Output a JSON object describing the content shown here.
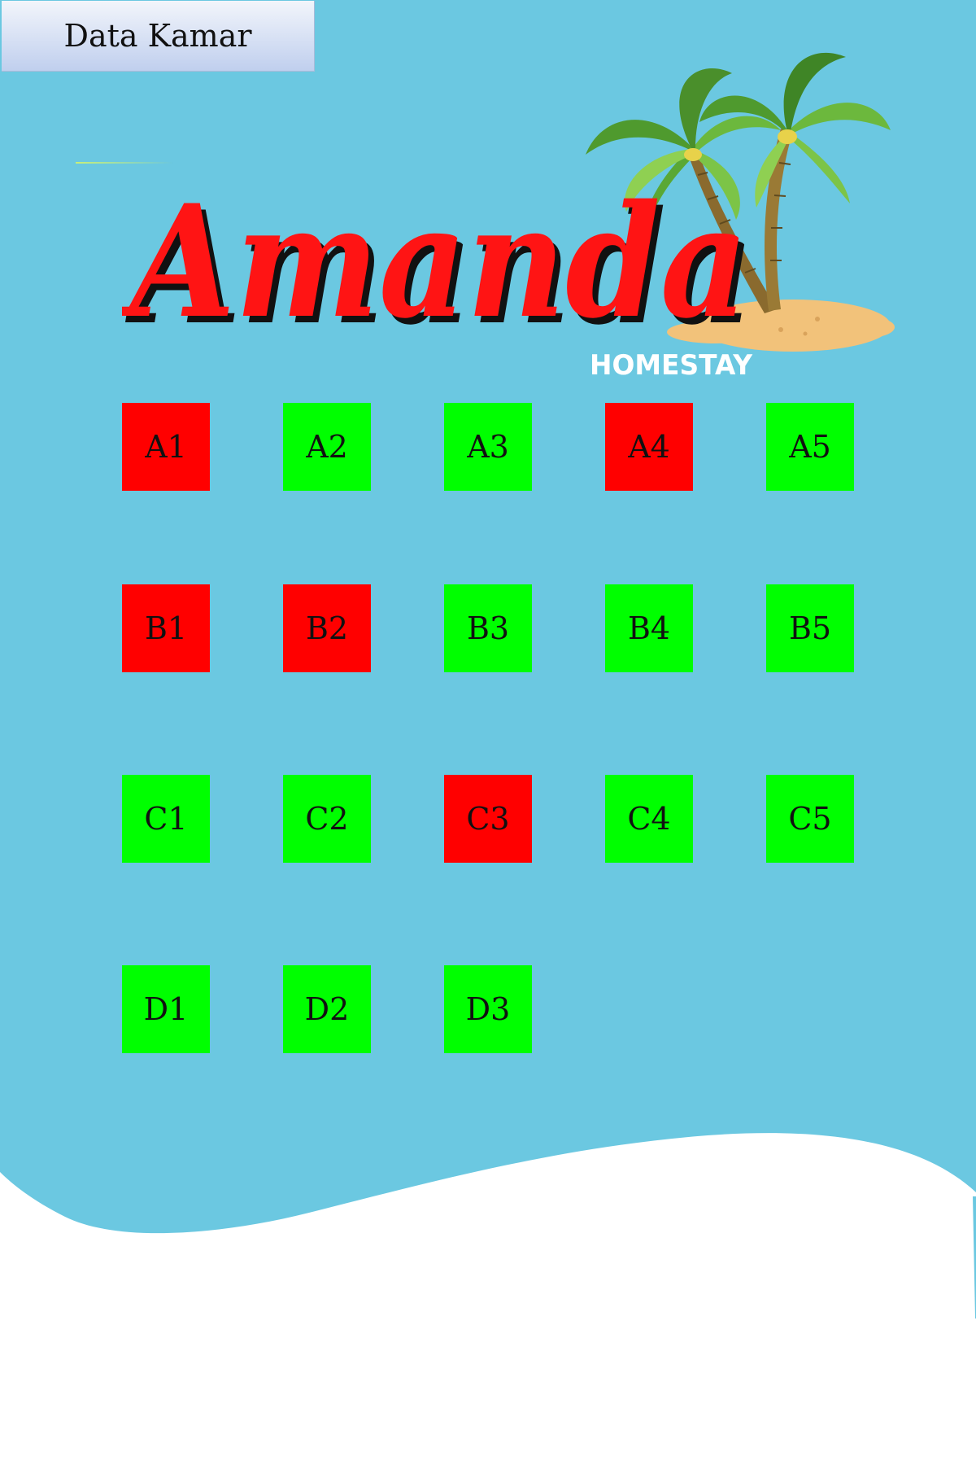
{
  "tab": {
    "label": "Data Kamar"
  },
  "brand": {
    "name": "Amanda",
    "tagline": "HOMESTAY"
  },
  "colors": {
    "background": "#6bc8e1",
    "available": "#00ff00",
    "occupied": "#ff0000",
    "logo_red": "#ff1414",
    "logo_shadow": "#111111"
  },
  "rooms": [
    {
      "label": "A1",
      "status": "occupied"
    },
    {
      "label": "A2",
      "status": "available"
    },
    {
      "label": "A3",
      "status": "available"
    },
    {
      "label": "A4",
      "status": "occupied"
    },
    {
      "label": "A5",
      "status": "available"
    },
    {
      "label": "B1",
      "status": "occupied"
    },
    {
      "label": "B2",
      "status": "occupied"
    },
    {
      "label": "B3",
      "status": "available"
    },
    {
      "label": "B4",
      "status": "available"
    },
    {
      "label": "B5",
      "status": "available"
    },
    {
      "label": "C1",
      "status": "available"
    },
    {
      "label": "C2",
      "status": "available"
    },
    {
      "label": "C3",
      "status": "occupied"
    },
    {
      "label": "C4",
      "status": "available"
    },
    {
      "label": "C5",
      "status": "available"
    },
    {
      "label": "D1",
      "status": "available"
    },
    {
      "label": "D2",
      "status": "available"
    },
    {
      "label": "D3",
      "status": "available"
    }
  ]
}
